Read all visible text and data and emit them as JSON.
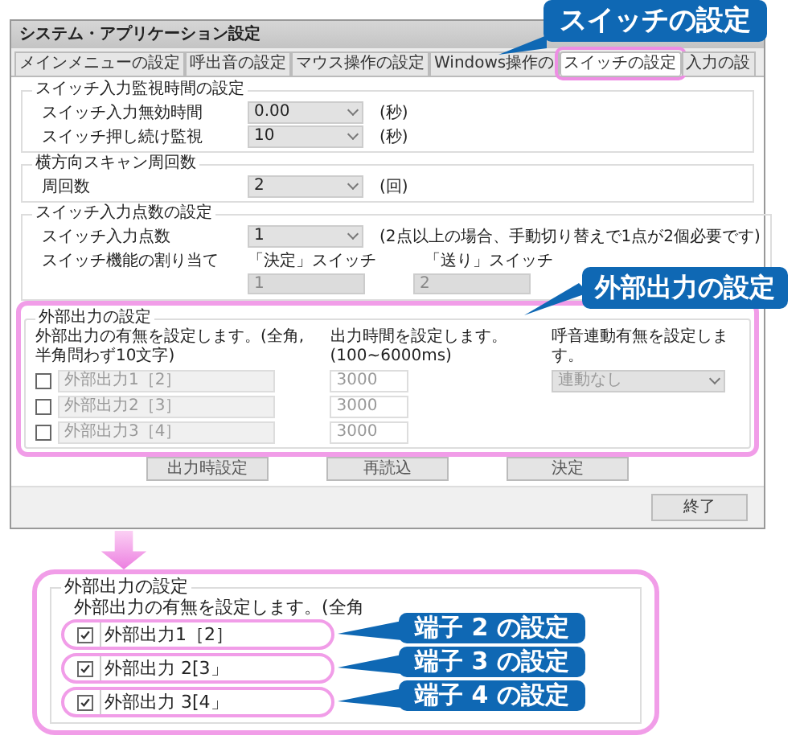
{
  "window": {
    "title": "システム・アプリケーション設定",
    "tabs": [
      {
        "label": "メインメニューの設定",
        "selected": false
      },
      {
        "label": "呼出音の設定",
        "selected": false
      },
      {
        "label": "マウス操作の設定",
        "selected": false
      },
      {
        "label": "Windows操作の",
        "selected": false
      },
      {
        "label": "スイッチの設定",
        "selected": true
      },
      {
        "label": "入力の設",
        "selected": false
      }
    ],
    "monitor_group": {
      "legend": "スイッチ入力監視時間の設定",
      "rows": [
        {
          "label": "スイッチ入力無効時間",
          "value": "0.00",
          "unit": "(秒)"
        },
        {
          "label": "スイッチ押し続け監視",
          "value": "10",
          "unit": "(秒)"
        }
      ]
    },
    "scan_group": {
      "legend": "横方向スキャン周回数",
      "rows": [
        {
          "label": "周回数",
          "value": "2",
          "unit": "(回)"
        }
      ]
    },
    "input_group": {
      "legend": "スイッチ入力点数の設定",
      "label": "スイッチ入力点数",
      "value": "1",
      "note": "(2点以上の場合、手動切り替えで1点が2個必要です)",
      "assign_label": "スイッチ機能の割り当て",
      "assignments": [
        {
          "label": "「決定」スイッチ",
          "value": "1"
        },
        {
          "label": "「送り」スイッチ",
          "value": "2"
        }
      ]
    },
    "output_group": {
      "legend": "外部出力の設定",
      "descriptions": [
        "外部出力の有無を設定します。(全角,半角問わず10文字)",
        "出力時間を設定します。(100~6000ms)",
        "呼音連動有無を設定します。"
      ],
      "rows": [
        {
          "checked": false,
          "disabled": true,
          "name": "外部出力1［2］",
          "time": "3000",
          "link": "連動なし"
        },
        {
          "checked": false,
          "disabled": true,
          "name": "外部出力2［3］",
          "time": "3000"
        },
        {
          "checked": false,
          "disabled": true,
          "name": "外部出力3［4］",
          "time": "3000"
        }
      ]
    },
    "buttons": [
      "出力時設定",
      "再読込",
      "決定"
    ],
    "footer_button": "終了"
  },
  "callouts": [
    "スイッチの設定",
    "外部出力の設定"
  ],
  "zoom": {
    "legend": "外部出力の設定",
    "description": "外部出力の有無を設定します。(全角",
    "rows": [
      {
        "checked": true,
        "name": "外部出力1［2］",
        "callout": "端子 2 の設定"
      },
      {
        "checked": true,
        "name": "外部出力 2[3」",
        "callout": "端子 3 の設定"
      },
      {
        "checked": true,
        "name": "外部出力 3[4」",
        "callout": "端子 4 の設定"
      }
    ]
  }
}
